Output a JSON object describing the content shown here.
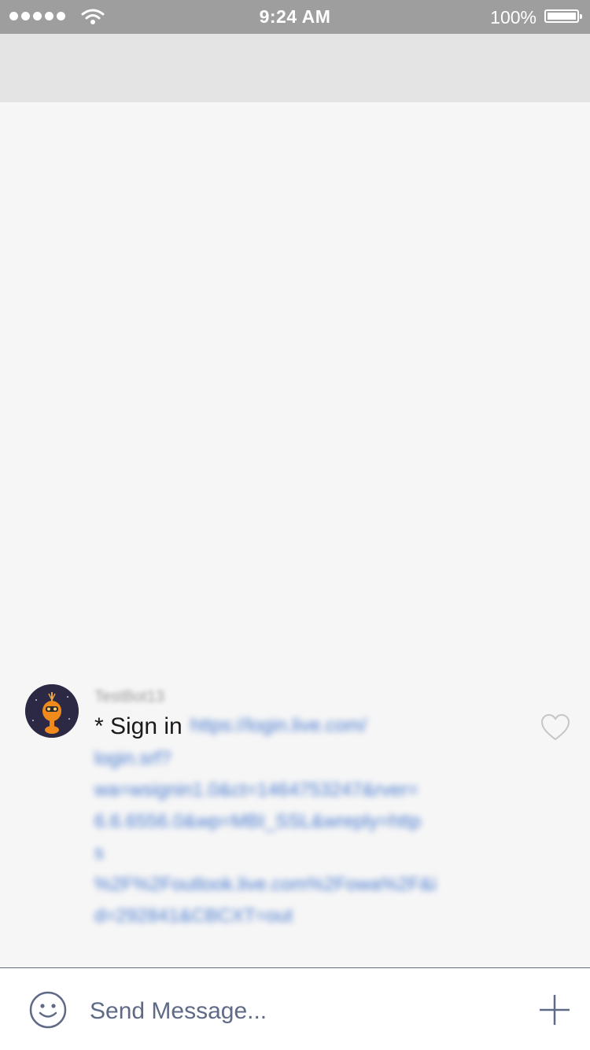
{
  "status_bar": {
    "time": "9:24 AM",
    "battery": "100%",
    "signal_icon": "signal-dots-icon",
    "wifi_icon": "wifi-icon",
    "battery_icon": "battery-icon"
  },
  "message": {
    "sender": "TestBot13",
    "prefix": "* Sign in",
    "link_lines": [
      "https://login.live.com/",
      "login.srf?",
      "wa=wsignin1.0&ct=1464753247&rver=",
      "6.6.6556.0&wp=MBI_SSL&wreply=http",
      "s",
      "%2F%2Foutlook.live.com%2Fowa%2F&i",
      "d=292841&CBCXT=out"
    ],
    "avatar_icon": "robot-avatar-icon",
    "like_icon": "heart-icon"
  },
  "composer": {
    "placeholder": "Send Message...",
    "emoji_icon": "smiley-icon",
    "add_icon": "plus-icon"
  },
  "colors": {
    "status_bar": "#9e9e9e",
    "header": "#e4e4e4",
    "background": "#f6f6f6",
    "link": "#4a7bd0",
    "composer_accent": "#5f6a86"
  }
}
